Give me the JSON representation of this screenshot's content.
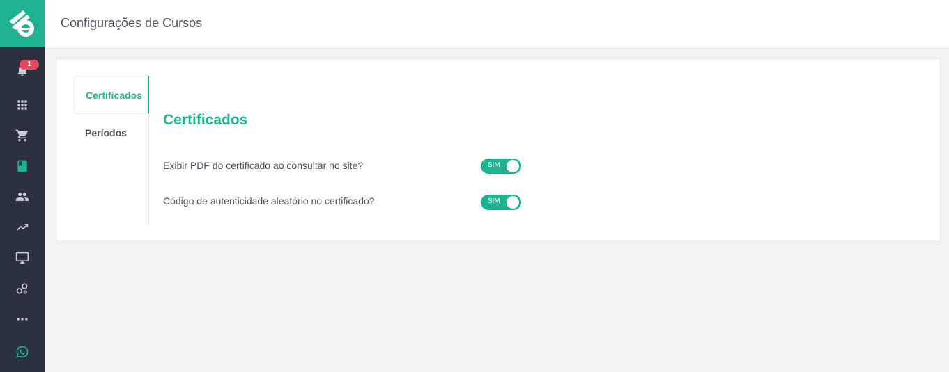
{
  "sidebar": {
    "notification_count": "1",
    "items": [
      {
        "icon": "bell-icon"
      },
      {
        "icon": "apps-grid-icon"
      },
      {
        "icon": "shopping-cart-icon"
      },
      {
        "icon": "book-icon"
      },
      {
        "icon": "people-icon"
      },
      {
        "icon": "trending-up-icon"
      },
      {
        "icon": "monitor-icon"
      },
      {
        "icon": "bubbles-icon"
      },
      {
        "icon": "more-horizontal-icon"
      },
      {
        "icon": "whatsapp-icon"
      }
    ]
  },
  "header": {
    "title": "Configurações de Cursos"
  },
  "tabs": [
    {
      "label": "Certificados",
      "active": true
    },
    {
      "label": "Períodos",
      "active": false
    }
  ],
  "section": {
    "title": "Certificados",
    "settings": [
      {
        "label": "Exibir PDF do certificado ao consultar no site?",
        "toggle_label": "SIM",
        "enabled": true
      },
      {
        "label": "Código de autenticidade aleatório no certificado?",
        "toggle_label": "SIM",
        "enabled": true
      }
    ]
  },
  "colors": {
    "accent": "#1db38f",
    "sidebar": "#2b3140",
    "badge": "#e8475a"
  }
}
